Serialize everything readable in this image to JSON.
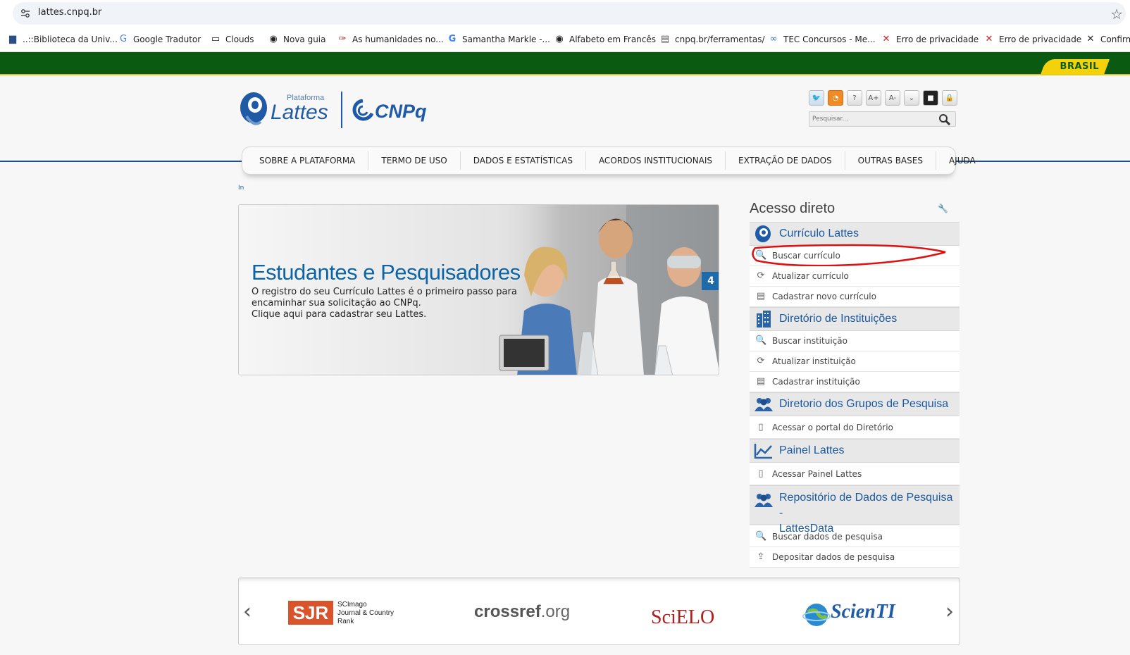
{
  "browser": {
    "url": "lattes.cnpq.br",
    "bookmarks": [
      {
        "label": "..::Biblioteca da Univ...",
        "icon": "library-icon"
      },
      {
        "label": "Google Tradutor",
        "icon": "translate-icon"
      },
      {
        "label": "Clouds",
        "icon": "folder-icon"
      },
      {
        "label": "Nova guia",
        "icon": "globe-icon"
      },
      {
        "label": "As humanidades no...",
        "icon": "feather-icon"
      },
      {
        "label": "Samantha Markle -...",
        "icon": "google-icon"
      },
      {
        "label": "Alfabeto em Francês",
        "icon": "globe-icon"
      },
      {
        "label": "cnpq.br/ferramentas/",
        "icon": "page-icon"
      },
      {
        "label": "TEC Concursos - Me...",
        "icon": "tec-icon"
      },
      {
        "label": "Erro de privacidade",
        "icon": "warning-x-icon"
      },
      {
        "label": "Erro de privacidade",
        "icon": "warning-x-icon"
      },
      {
        "label": "Confirm",
        "icon": "close-icon"
      }
    ]
  },
  "govbar": {
    "label": "BRASIL"
  },
  "header": {
    "logo_small": "Plataforma",
    "logo_main": "Lattes",
    "partner_logo": "CNPq",
    "tools": [
      "twitter-icon",
      "rss-icon",
      "?",
      "A+",
      "A-",
      "chevron-down-icon",
      "contrast-icon",
      "lock-icon"
    ],
    "search_placeholder": "Pesquisar..."
  },
  "nav": {
    "items": [
      "SOBRE A PLATAFORMA",
      "TERMO DE USO",
      "DADOS E ESTATÍSTICAS",
      "ACORDOS INSTITUCIONAIS",
      "EXTRAÇÃO DE DADOS",
      "OUTRAS BASES",
      "AJUDA"
    ]
  },
  "breadcrumb": "In",
  "banner": {
    "title": "Estudantes e Pesquisadores",
    "desc_line1": "O registro do seu Currículo Lattes é o primeiro passo para",
    "desc_line2": "encaminhar sua solicitação ao CNPq.",
    "desc_line3": "Clique aqui para cadastrar seu Lattes.",
    "slide_number": "4"
  },
  "sidebar": {
    "title": "Acesso direto",
    "sections": [
      {
        "title": "Currículo Lattes",
        "items": [
          "Buscar currículo",
          "Atualizar currículo",
          "Cadastrar novo currículo"
        ]
      },
      {
        "title": "Diretório de Instituições",
        "items": [
          "Buscar instituição",
          "Atualizar instituição",
          "Cadastrar instituição"
        ]
      },
      {
        "title": "Diretorio dos Grupos de Pesquisa",
        "items": [
          "Acessar o portal do Diretório"
        ]
      },
      {
        "title": "Painel Lattes",
        "items": [
          "Acessar Painel Lattes"
        ]
      },
      {
        "title_line1": "Repositório de Dados de Pesquisa -",
        "title_line2": "LattesData",
        "items": [
          "Buscar dados de pesquisa",
          "Depositar dados de pesquisa"
        ]
      }
    ]
  },
  "partners": {
    "sjr_logo": "SJR",
    "sjr_line1": "SCImago",
    "sjr_line2": "Journal & Country",
    "sjr_line3": "Rank",
    "crossref_bold": "crossref",
    "crossref_rest": ".org",
    "scielo": "SciELO",
    "scientti": "ScienTI"
  },
  "colors": {
    "gov_green": "#0b5a12",
    "gov_yellow": "#f4d20b",
    "link_blue": "#1b5aa0",
    "annotation_red": "#e01010"
  }
}
